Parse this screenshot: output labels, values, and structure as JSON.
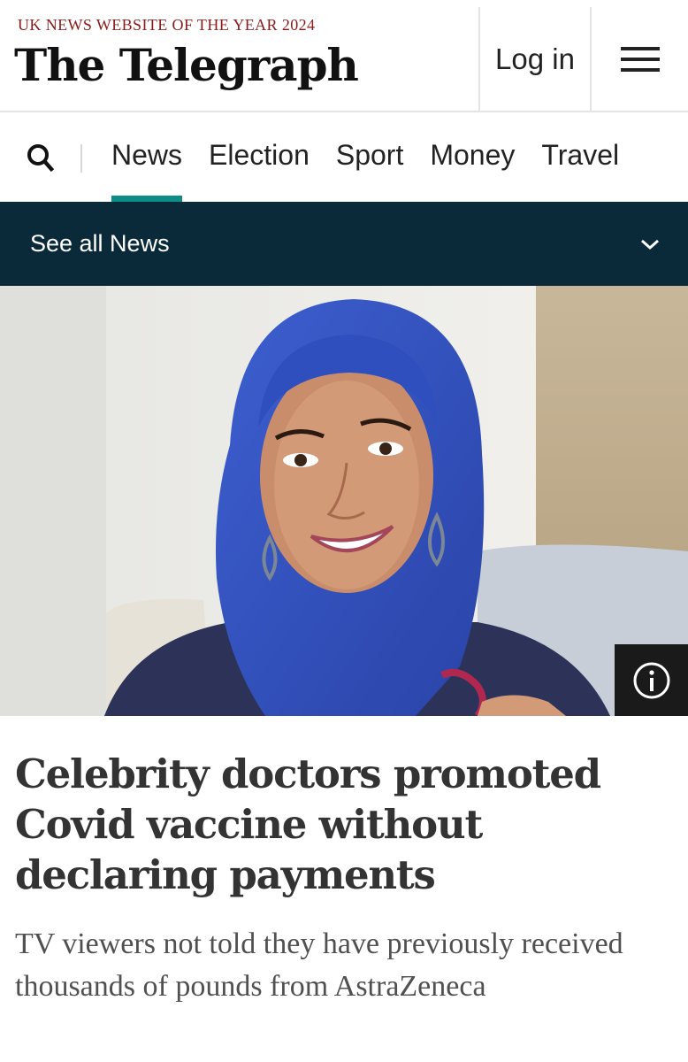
{
  "masthead": {
    "award": "UK NEWS WEBSITE OF THE YEAR 2024",
    "logo": "The Telegraph",
    "login_label": "Log in",
    "menu_icon": "hamburger-icon"
  },
  "nav": {
    "search_icon": "search-icon",
    "tabs": [
      {
        "label": "News",
        "active": true
      },
      {
        "label": "Election",
        "active": false
      },
      {
        "label": "Sport",
        "active": false
      },
      {
        "label": "Money",
        "active": false
      },
      {
        "label": "Travel",
        "active": false
      }
    ],
    "accent_color": "#0d8d85"
  },
  "section_bar": {
    "label": "See all News",
    "icon": "chevron-down-icon",
    "background": "#0a2a3a"
  },
  "hero": {
    "info_icon": "info-icon"
  },
  "article": {
    "headline": "Celebrity doctors promoted Covid vaccine without declaring payments",
    "standfirst": "TV viewers not told they have previously received thousands of pounds from AstraZeneca"
  }
}
